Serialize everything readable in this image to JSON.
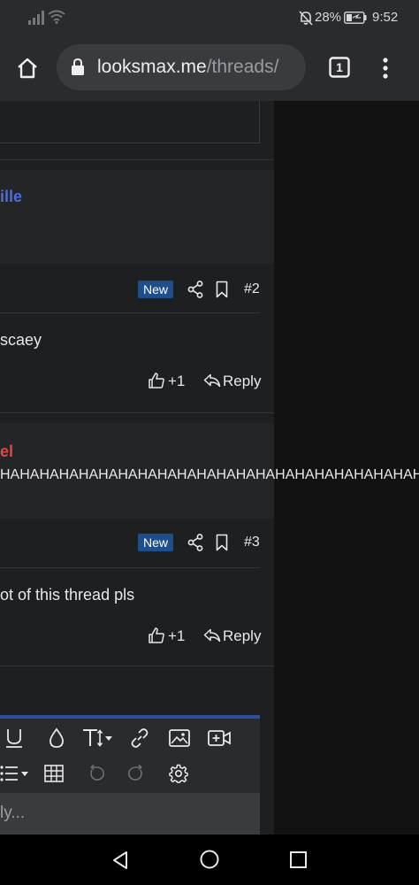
{
  "status_bar": {
    "battery": "28%",
    "time": "9:52"
  },
  "browser": {
    "url_domain": "looksmax.me",
    "url_path": "/threads/",
    "tab_count": "1"
  },
  "posts": [
    {
      "username": "ille",
      "username_color": "#4a6fdc"
    },
    {
      "badge": "New",
      "post_number": "#2",
      "body": "scaey",
      "like_count": "+1",
      "reply_label": "Reply"
    },
    {
      "username": "el",
      "username_color": "#e04848",
      "body": "HAHAHAHAHAHAHAHAHAHAHAHAHAHAHAHAHAHAHAHAHAHAHAHA"
    },
    {
      "badge": "New",
      "post_number": "#3",
      "body": "ot of this thread pls",
      "like_count": "+1",
      "reply_label": "Reply"
    }
  ],
  "editor": {
    "placeholder": "ly..."
  },
  "colors": {
    "accent": "#2f4f9c",
    "badge": "#1f4e8c"
  }
}
